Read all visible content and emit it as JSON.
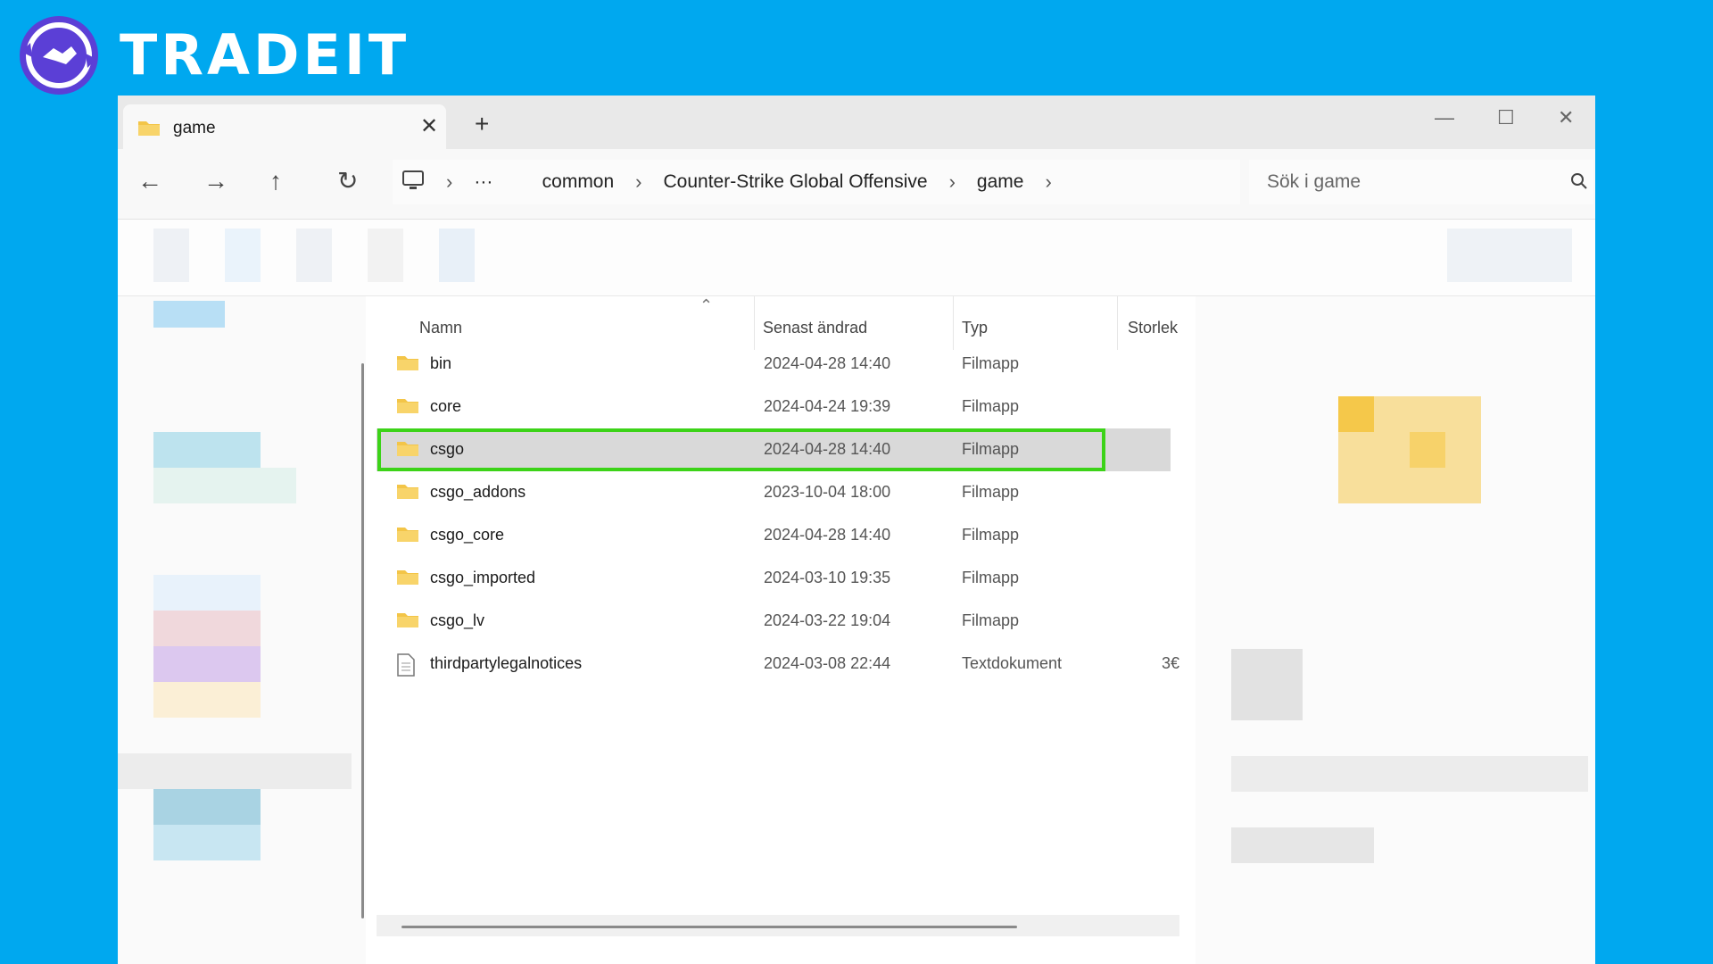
{
  "brand": {
    "name": "TRADEIT"
  },
  "colors": {
    "background": "#00a8ef",
    "highlight": "#3cd318",
    "folder": "#f3c548"
  },
  "tab": {
    "title": "game",
    "close_icon": "close-icon",
    "new_tab_icon": "plus-icon"
  },
  "window_controls": [
    "minimize-icon",
    "maximize-icon",
    "close-icon"
  ],
  "nav": {
    "buttons": [
      "back-icon",
      "forward-icon",
      "up-icon",
      "refresh-icon"
    ],
    "breadcrumb": [
      "common",
      "Counter-Strike Global Offensive",
      "game"
    ],
    "overflow": "···",
    "search_placeholder": "Sök i game"
  },
  "list": {
    "columns": {
      "name": "Namn",
      "modified": "Senast ändrad",
      "type": "Typ",
      "size": "Storlek"
    },
    "rows": [
      {
        "name": "bin",
        "modified": "2024-04-28 14:40",
        "type": "Filmapp",
        "size": "",
        "kind": "folder"
      },
      {
        "name": "core",
        "modified": "2024-04-24 19:39",
        "type": "Filmapp",
        "size": "",
        "kind": "folder"
      },
      {
        "name": "csgo",
        "modified": "2024-04-28 14:40",
        "type": "Filmapp",
        "size": "",
        "kind": "folder",
        "selected": true
      },
      {
        "name": "csgo_addons",
        "modified": "2023-10-04 18:00",
        "type": "Filmapp",
        "size": "",
        "kind": "folder"
      },
      {
        "name": "csgo_core",
        "modified": "2024-04-28 14:40",
        "type": "Filmapp",
        "size": "",
        "kind": "folder"
      },
      {
        "name": "csgo_imported",
        "modified": "2024-03-10 19:35",
        "type": "Filmapp",
        "size": "",
        "kind": "folder"
      },
      {
        "name": "csgo_lv",
        "modified": "2024-03-22 19:04",
        "type": "Filmapp",
        "size": "",
        "kind": "folder"
      },
      {
        "name": "thirdpartylegalnotices",
        "modified": "2024-03-08 22:44",
        "type": "Textdokument",
        "size": "3€",
        "kind": "file"
      }
    ]
  }
}
